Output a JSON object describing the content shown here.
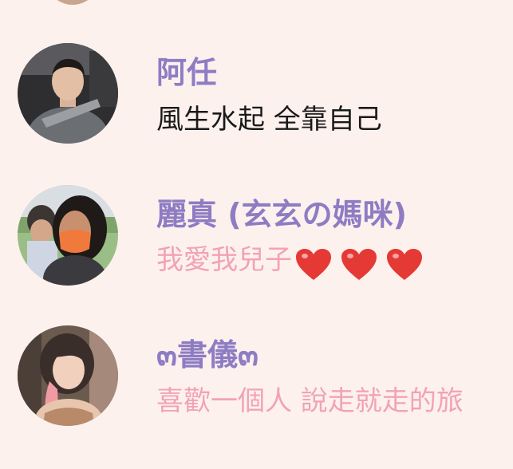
{
  "contacts": [
    {
      "name": "阿任",
      "status": "風生水起 全靠自己",
      "status_color": "#1A1A1A"
    },
    {
      "name": "麗真 (玄玄の媽咪)",
      "status": "我愛我兒子",
      "status_emoji": [
        "heart-emoji",
        "heart-emoji",
        "heart-emoji"
      ],
      "status_color": "#F2A3B1"
    },
    {
      "name": "๓書儀๓",
      "status": "喜歡一個人 說走就走的旅",
      "status_color": "#F2A3B1"
    }
  ],
  "colors": {
    "background": "#FDF1EE",
    "name": "#8E7CC3",
    "status_pink": "#F2A3B1",
    "heart": "#E53935"
  }
}
